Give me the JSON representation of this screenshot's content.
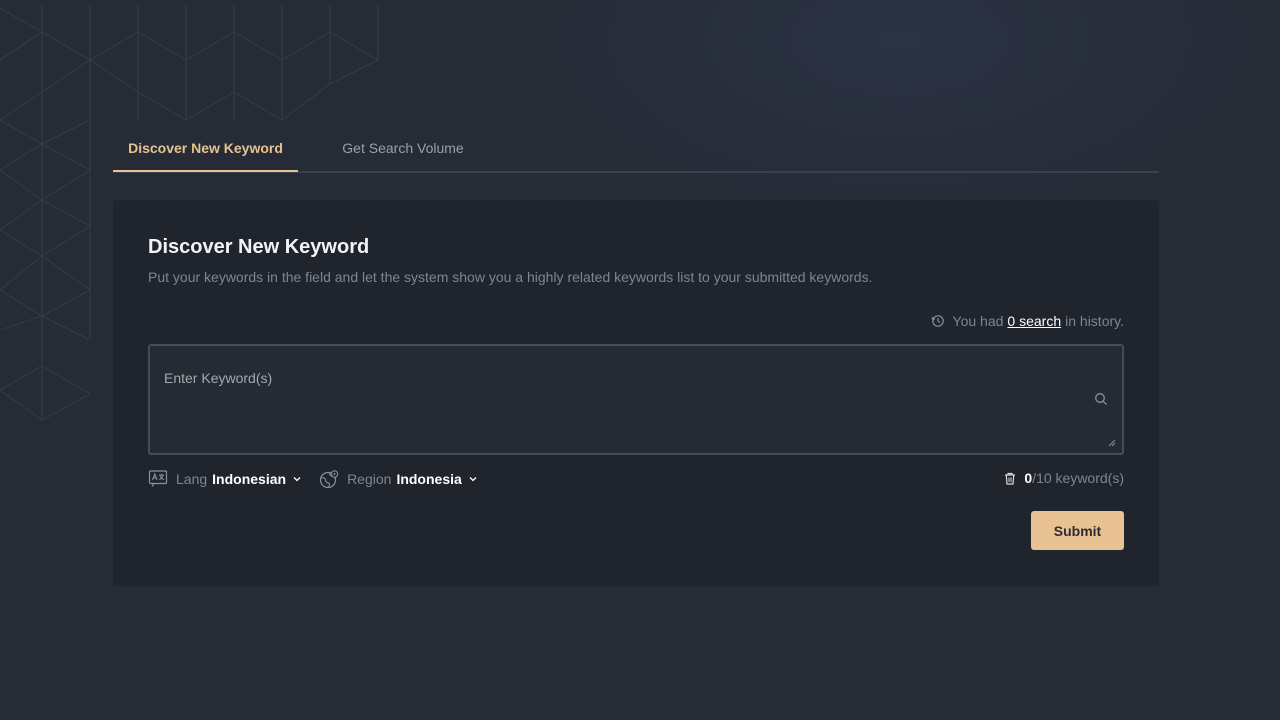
{
  "tabs": [
    {
      "label": "Discover New Keyword",
      "active": true
    },
    {
      "label": "Get Search Volume",
      "active": false
    }
  ],
  "card": {
    "title": "Discover New Keyword",
    "description": "Put your keywords in the field and let the system show you a highly related keywords list to your submitted keywords."
  },
  "history": {
    "prefix": "You had",
    "link": "0 search",
    "suffix": "in history."
  },
  "keyword_input": {
    "placeholder": "Enter Keyword(s)",
    "value": ""
  },
  "options": {
    "lang_label": "Lang",
    "lang_value": "Indonesian",
    "region_label": "Region",
    "region_value": "Indonesia"
  },
  "counter": {
    "current": "0",
    "total": "/10 keyword(s)"
  },
  "submit_label": "Submit",
  "colors": {
    "accent": "#e6c391",
    "background": "#262b36",
    "card": "#20242c"
  },
  "icons": {
    "history": "clock-history-icon",
    "search": "search-icon",
    "lang": "translate-icon",
    "region": "globe-icon",
    "chevron": "chevron-down-icon",
    "trash": "trash-icon"
  }
}
